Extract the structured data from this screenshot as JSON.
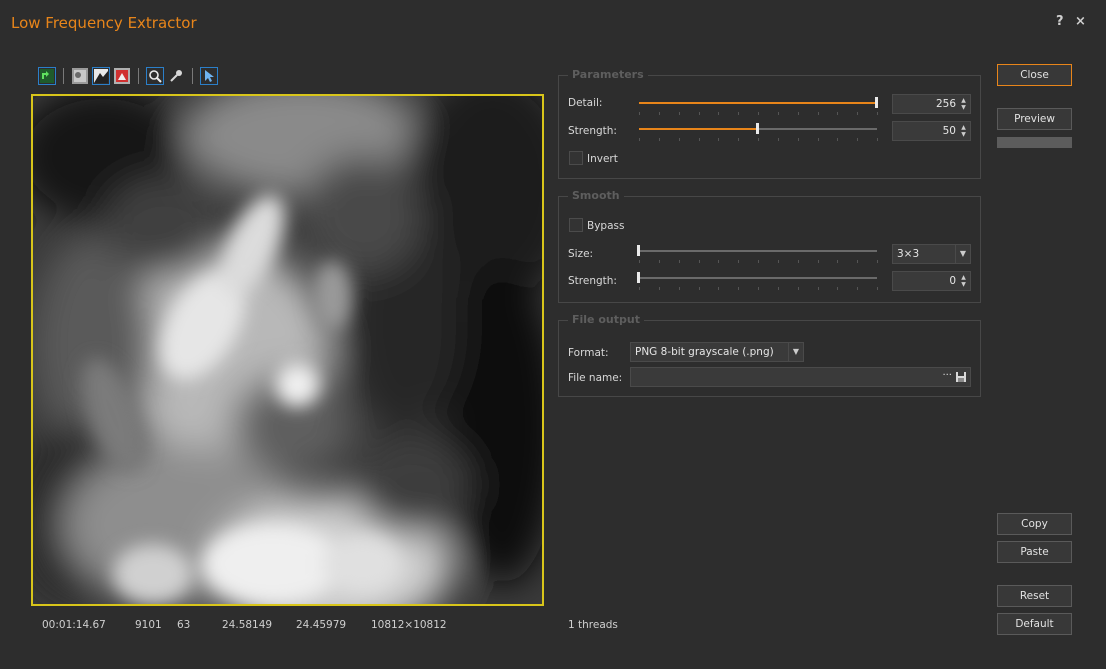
{
  "window": {
    "title": "Low Frequency Extractor",
    "help": "?",
    "close": "×"
  },
  "toolbar": {
    "icons": [
      "rotate-icon",
      "grayscale-image-icon",
      "contrast-image-icon",
      "red-image-icon",
      "zoom-icon",
      "eyedropper-icon",
      "pointer-icon"
    ]
  },
  "status": {
    "time": "00:01:14.67",
    "value1": "9101",
    "value2": "63",
    "value3": "24.58149",
    "value4": "24.45979",
    "resolution": "10812×10812",
    "threads": "1 threads"
  },
  "parameters": {
    "title": "Parameters",
    "detail_label": "Detail:",
    "detail_value": "256",
    "detail_fraction": 1.0,
    "strength_label": "Strength:",
    "strength_value": "50",
    "strength_fraction": 0.5,
    "invert_label": "Invert",
    "invert_checked": false
  },
  "smooth": {
    "title": "Smooth",
    "bypass_label": "Bypass",
    "bypass_checked": false,
    "size_label": "Size:",
    "size_value": "3×3",
    "size_fraction": 0.0,
    "strength_label": "Strength:",
    "strength_value": "0",
    "strength_fraction": 0.0
  },
  "file_output": {
    "title": "File output",
    "format_label": "Format:",
    "format_value": "PNG 8-bit grayscale (.png)",
    "filename_label": "File name:",
    "filename_value": "",
    "browse_label": "···"
  },
  "buttons": {
    "close": "Close",
    "preview": "Preview",
    "copy": "Copy",
    "paste": "Paste",
    "reset": "Reset",
    "default": "Default"
  },
  "colors": {
    "accent": "#e8851a",
    "frame": "#d8c51a",
    "selection": "#2b7fc9"
  }
}
